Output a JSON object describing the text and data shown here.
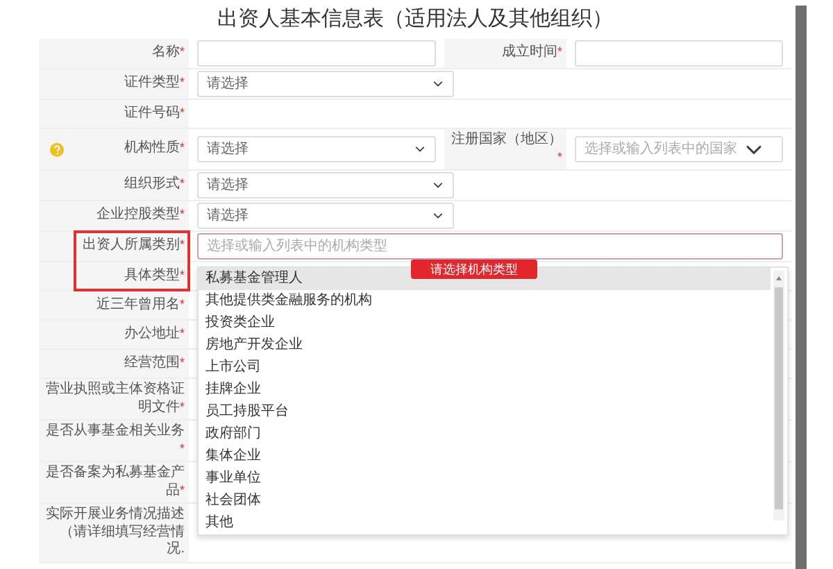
{
  "title": "出资人基本信息表（适用法人及其他组织）",
  "rows": [
    {
      "label": "名称",
      "mark": "*",
      "kind": "input",
      "help": false,
      "highlighted": false,
      "second": {
        "label": "成立时间",
        "mark": "*",
        "kind": "input"
      }
    },
    {
      "label": "证件类型",
      "mark": "*",
      "kind": "select",
      "value": "请选择",
      "help": false,
      "highlighted": false
    },
    {
      "label": "证件号码",
      "mark": "*",
      "kind": "none",
      "help": false,
      "highlighted": false
    },
    {
      "label": "机构性质",
      "mark": "*",
      "kind": "select",
      "value": "请选择",
      "help": true,
      "highlighted": false,
      "second": {
        "label": "注册国家（地区）",
        "mark": "*",
        "kind": "combo",
        "placeholder": "选择或输入列表中的国家",
        "caret": true,
        "focused": false
      }
    },
    {
      "label": "组织形式",
      "mark": "*",
      "kind": "select",
      "value": "请选择",
      "help": false,
      "highlighted": false
    },
    {
      "label": "企业控股类型",
      "mark": "*",
      "kind": "select",
      "value": "请选择",
      "help": false,
      "highlighted": false
    },
    {
      "label": "出资人所属类别",
      "mark": "*",
      "kind": "combo",
      "placeholder": "选择或输入列表中的机构类型",
      "caret": false,
      "focused": true,
      "help": false,
      "highlighted": true,
      "error": "请选择机构类型",
      "options": [
        {
          "label": "私募基金管理人",
          "selected": true
        },
        {
          "label": "其他提供类金融服务的机构",
          "selected": false
        },
        {
          "label": "投资类企业",
          "selected": false
        },
        {
          "label": "房地产开发企业",
          "selected": false
        },
        {
          "label": "上市公司",
          "selected": false
        },
        {
          "label": "挂牌企业",
          "selected": false
        },
        {
          "label": "员工持股平台",
          "selected": false
        },
        {
          "label": "政府部门",
          "selected": false
        },
        {
          "label": "集体企业",
          "selected": false
        },
        {
          "label": "事业单位",
          "selected": false
        },
        {
          "label": "社会团体",
          "selected": false
        },
        {
          "label": "其他",
          "selected": false
        }
      ]
    },
    {
      "label": "具体类型",
      "mark": "*",
      "kind": "none",
      "help": false,
      "highlighted": true
    },
    {
      "label": "近三年曾用名",
      "mark": "*",
      "kind": "none",
      "help": false,
      "highlighted": false
    },
    {
      "label": "办公地址",
      "mark": "*",
      "kind": "none",
      "help": false,
      "highlighted": false
    },
    {
      "label": "经营范围",
      "mark": "*",
      "kind": "none",
      "help": false,
      "highlighted": false
    },
    {
      "label": "营业执照或主体资格证明文件",
      "mark": "*",
      "kind": "none",
      "help": false,
      "highlighted": false
    },
    {
      "label": "是否从事基金相关业务",
      "mark": "*",
      "kind": "none",
      "help": false,
      "highlighted": false
    },
    {
      "label": "是否备案为私募基金产品",
      "mark": "*",
      "kind": "none",
      "help": false,
      "highlighted": false
    },
    {
      "label": "实际开展业务情况描述（请详细填写经营情况.",
      "mark": "",
      "kind": "none",
      "help": false,
      "highlighted": false
    }
  ]
}
